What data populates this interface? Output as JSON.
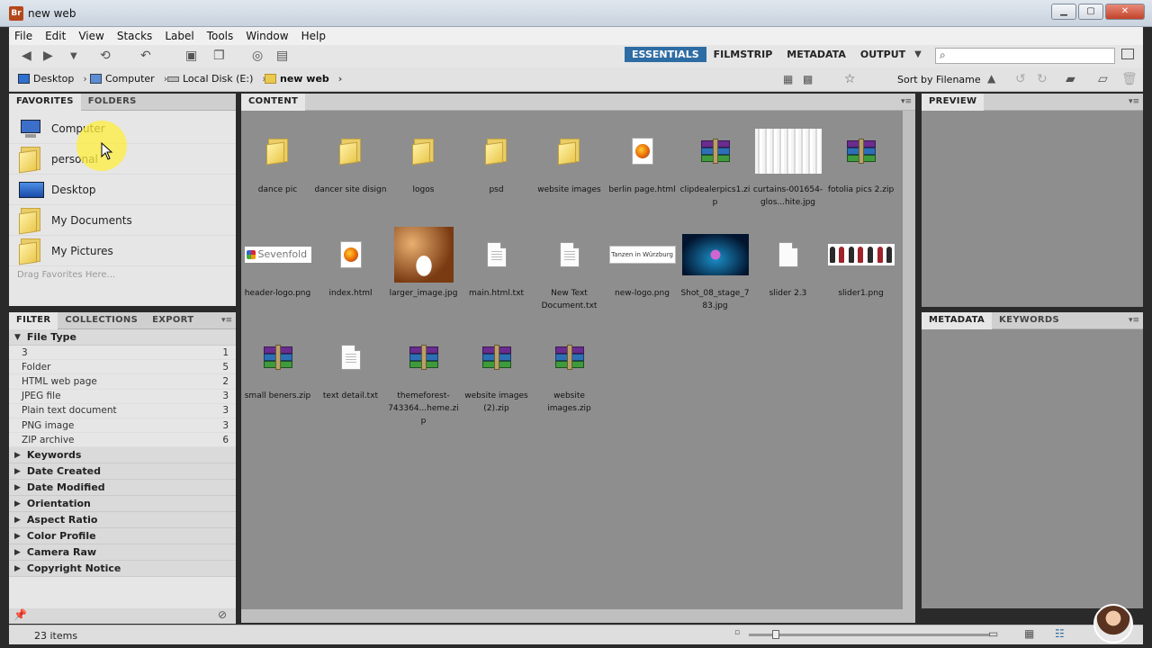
{
  "window": {
    "title": "new web",
    "app_icon": "Br"
  },
  "menu": [
    "File",
    "Edit",
    "View",
    "Stacks",
    "Label",
    "Tools",
    "Window",
    "Help"
  ],
  "workspaces": {
    "items": [
      "ESSENTIALS",
      "FILMSTRIP",
      "METADATA",
      "OUTPUT"
    ],
    "active": "ESSENTIALS",
    "accent": "#2e6ca4"
  },
  "search": {
    "placeholder": ""
  },
  "path": [
    {
      "label": "Desktop",
      "icon": "desktop-icon"
    },
    {
      "label": "Computer",
      "icon": "computer-icon"
    },
    {
      "label": "Local Disk (E:)",
      "icon": "disk-icon"
    },
    {
      "label": "new web",
      "icon": "folder-icon"
    }
  ],
  "sort": {
    "label": "Sort by Filename"
  },
  "left_top_panel": {
    "tabs": [
      "FAVORITES",
      "FOLDERS"
    ],
    "favorites": [
      {
        "label": "Computer",
        "icon": "computer-icon"
      },
      {
        "label": "personal",
        "icon": "folder-icon"
      },
      {
        "label": "Desktop",
        "icon": "desktop-icon"
      },
      {
        "label": "My Documents",
        "icon": "documents-icon"
      },
      {
        "label": "My Pictures",
        "icon": "pictures-icon"
      }
    ],
    "hint": "Drag Favorites Here..."
  },
  "filter_panel": {
    "tabs": [
      "FILTER",
      "COLLECTIONS",
      "EXPORT"
    ],
    "file_type": {
      "header": "File Type",
      "rows": [
        {
          "label": "3",
          "count": "1"
        },
        {
          "label": "Folder",
          "count": "5"
        },
        {
          "label": "HTML web page",
          "count": "2"
        },
        {
          "label": "JPEG file",
          "count": "3"
        },
        {
          "label": "Plain text document",
          "count": "3"
        },
        {
          "label": "PNG image",
          "count": "3"
        },
        {
          "label": "ZIP archive",
          "count": "6"
        }
      ]
    },
    "collapsed": [
      "Keywords",
      "Date Created",
      "Date Modified",
      "Orientation",
      "Aspect Ratio",
      "Color Profile",
      "Camera Raw",
      "Copyright Notice"
    ]
  },
  "content": {
    "tab": "CONTENT",
    "items": [
      {
        "label": "dance pic",
        "kind": "folder"
      },
      {
        "label": "dancer site disign",
        "kind": "folder"
      },
      {
        "label": "logos",
        "kind": "folder"
      },
      {
        "label": "psd",
        "kind": "folder"
      },
      {
        "label": "website images",
        "kind": "folder"
      },
      {
        "label": "berlin page.html",
        "kind": "html"
      },
      {
        "label": "clipdealerpics1.zip",
        "kind": "zip"
      },
      {
        "label": "curtains-001654-glos...hite.jpg",
        "kind": "curtain"
      },
      {
        "label": "fotolia pics 2.zip",
        "kind": "zip"
      },
      {
        "label": "header-logo.png",
        "kind": "sevenfold"
      },
      {
        "label": "index.html",
        "kind": "html"
      },
      {
        "label": "larger_image.jpg",
        "kind": "wedding"
      },
      {
        "label": "main.html.txt",
        "kind": "doc"
      },
      {
        "label": "New Text Document.txt",
        "kind": "doc"
      },
      {
        "label": "new-logo.png",
        "kind": "tanzen"
      },
      {
        "label": "Shot_08_stage_783.jpg",
        "kind": "dance"
      },
      {
        "label": "slider 2.3",
        "kind": "blank"
      },
      {
        "label": "slider1.png",
        "kind": "slider"
      },
      {
        "label": "small beners.zip",
        "kind": "zip"
      },
      {
        "label": "text detail.txt",
        "kind": "doc"
      },
      {
        "label": "themeforest-743364...heme.zip",
        "kind": "zip"
      },
      {
        "label": "website images (2).zip",
        "kind": "zip"
      },
      {
        "label": "website images.zip",
        "kind": "zip"
      }
    ],
    "thumb_texts": {
      "sevenfold": "Sevenfold",
      "tanzen": "Tanzen in Würzburg"
    }
  },
  "preview_panel": {
    "tab": "PREVIEW"
  },
  "metadata_panel": {
    "tabs": [
      "METADATA",
      "KEYWORDS"
    ]
  },
  "status": {
    "items_count": "23 items"
  }
}
